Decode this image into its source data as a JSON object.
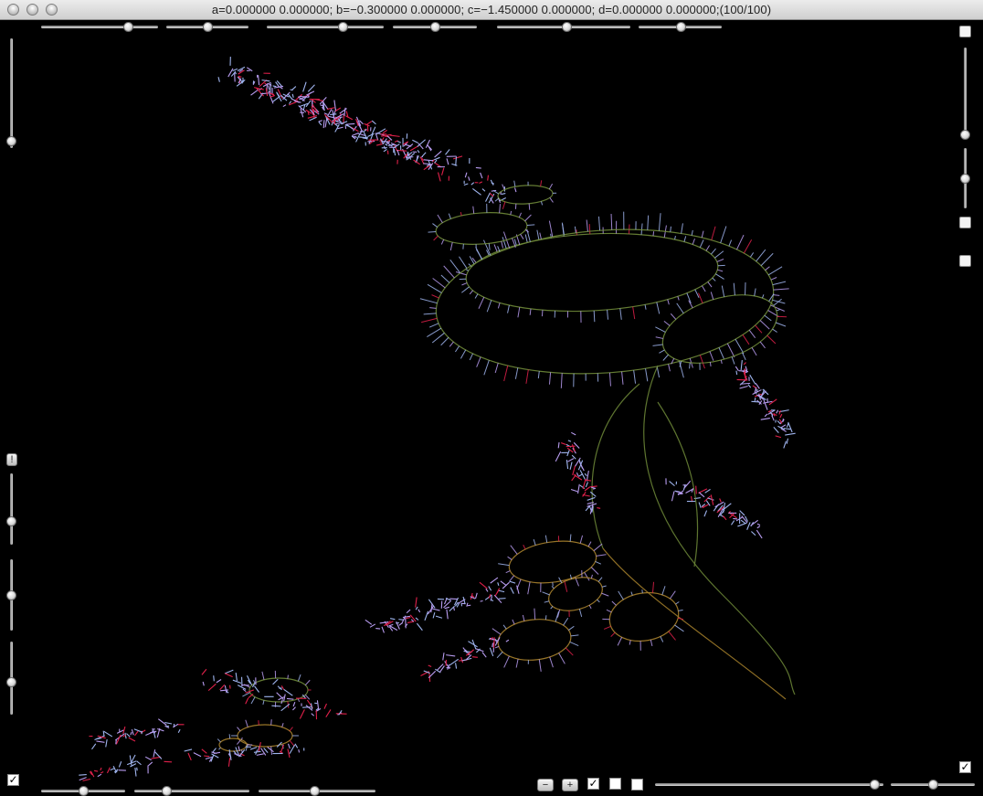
{
  "window": {
    "title": "a=0.000000 0.000000; b=−0.300000 0.000000; c=−1.450000 0.000000; d=0.000000 0.000000;(100/100)"
  },
  "colors": {
    "background": "#000000",
    "curve_green": "#6f8a38",
    "curve_orange": "#a8822c",
    "fringe_lavender": "#b89cf0",
    "fringe_blue": "#9fb4ee",
    "fringe_red": "#e0204a"
  },
  "controls": {
    "minus_label": "−",
    "plus_label": "+",
    "checkbox_mark": "✓",
    "info_label": "!",
    "checkboxes_bottom": [
      true,
      false,
      false
    ],
    "checkbox_left_bottom": true,
    "checkbox_right_bottom": true,
    "top_sliders": [
      0.74,
      0.5,
      0.65,
      0.5,
      0.52,
      0.5
    ],
    "bottom_sliders": [
      0.5,
      0.28,
      0.48
    ],
    "bottom_right_sliders": [
      0.96,
      0.5
    ],
    "left_sliders": [
      0.93,
      0.67,
      0.5,
      0.55
    ],
    "right_sliders": [
      0.95,
      0.5
    ]
  }
}
